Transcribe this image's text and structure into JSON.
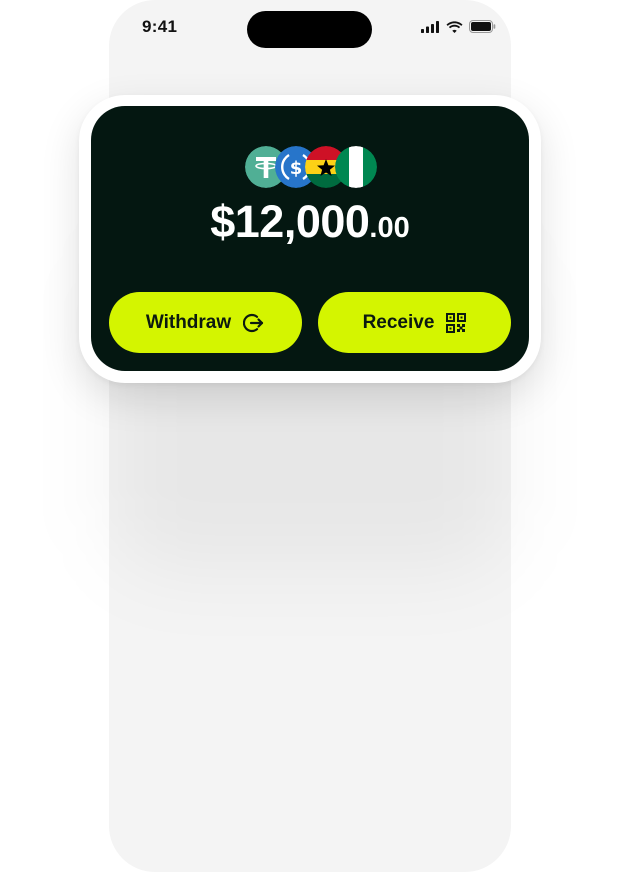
{
  "status_bar": {
    "time": "9:41",
    "icons": [
      "cellular-signal-icon",
      "wifi-icon",
      "battery-icon"
    ]
  },
  "wallet": {
    "currencies": [
      {
        "name": "tether-usdt-icon",
        "color": "#50AF95"
      },
      {
        "name": "usd-coin-icon",
        "color": "#2775CA"
      },
      {
        "name": "ghana-flag-icon",
        "colors": [
          "#CE1126",
          "#FCD116",
          "#006B3F"
        ]
      },
      {
        "name": "nigeria-flag-icon",
        "colors": [
          "#008751",
          "#FFFFFF",
          "#008751"
        ]
      }
    ],
    "balance_whole": "$12,000",
    "balance_cents": ".00"
  },
  "actions": {
    "withdraw_label": "Withdraw",
    "withdraw_icon": "logout-arrow-icon",
    "receive_label": "Receive",
    "receive_icon": "qr-code-icon"
  },
  "colors": {
    "card_background": "#041711",
    "accent": "#D4F500",
    "phone_background": "#F4F4F4"
  }
}
